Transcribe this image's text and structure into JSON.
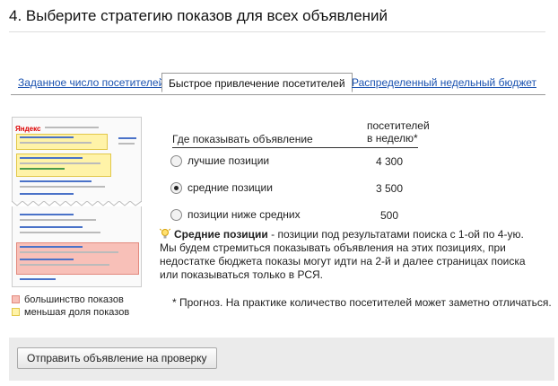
{
  "header": {
    "title": "4. Выберите стратегию показов для всех объявлений"
  },
  "tabs": [
    {
      "label": "Заданное число посетителей",
      "active": false
    },
    {
      "label": "Быстрое привлечение посетителей",
      "active": true
    },
    {
      "label": "Распределенный недельный бюджет",
      "active": false
    }
  ],
  "preview": {
    "logo": "Яндекс",
    "legend": [
      {
        "label": "большинство показов",
        "color": "#f8c0b8"
      },
      {
        "label": "меньшая доля показов",
        "color": "#fff3a8"
      }
    ]
  },
  "table": {
    "col_where": "Где показывать объявление",
    "col_visits_1": "посетителей",
    "col_visits_2": "в неделю*",
    "options": [
      {
        "label": "лучшие позиции",
        "count": "4 300",
        "checked": false
      },
      {
        "label": "средние позиции",
        "count": "3 500",
        "checked": true
      },
      {
        "label": "позиции ниже средних",
        "count": "500",
        "checked": false
      }
    ]
  },
  "description": {
    "bold": "Средние позиции",
    "text": " - позиции под результатами поиска с 1-ой по 4-ую. Мы будем стремиться показывать объявления на этих позициях, при недостатке бюджета показы могут идти на 2-й и далее страницах поиска или показываться только в РСЯ."
  },
  "note": "* Прогноз. На практике количество посетителей может заметно отличаться.",
  "footer": {
    "submit_label": "Отправить объявление на проверку"
  }
}
